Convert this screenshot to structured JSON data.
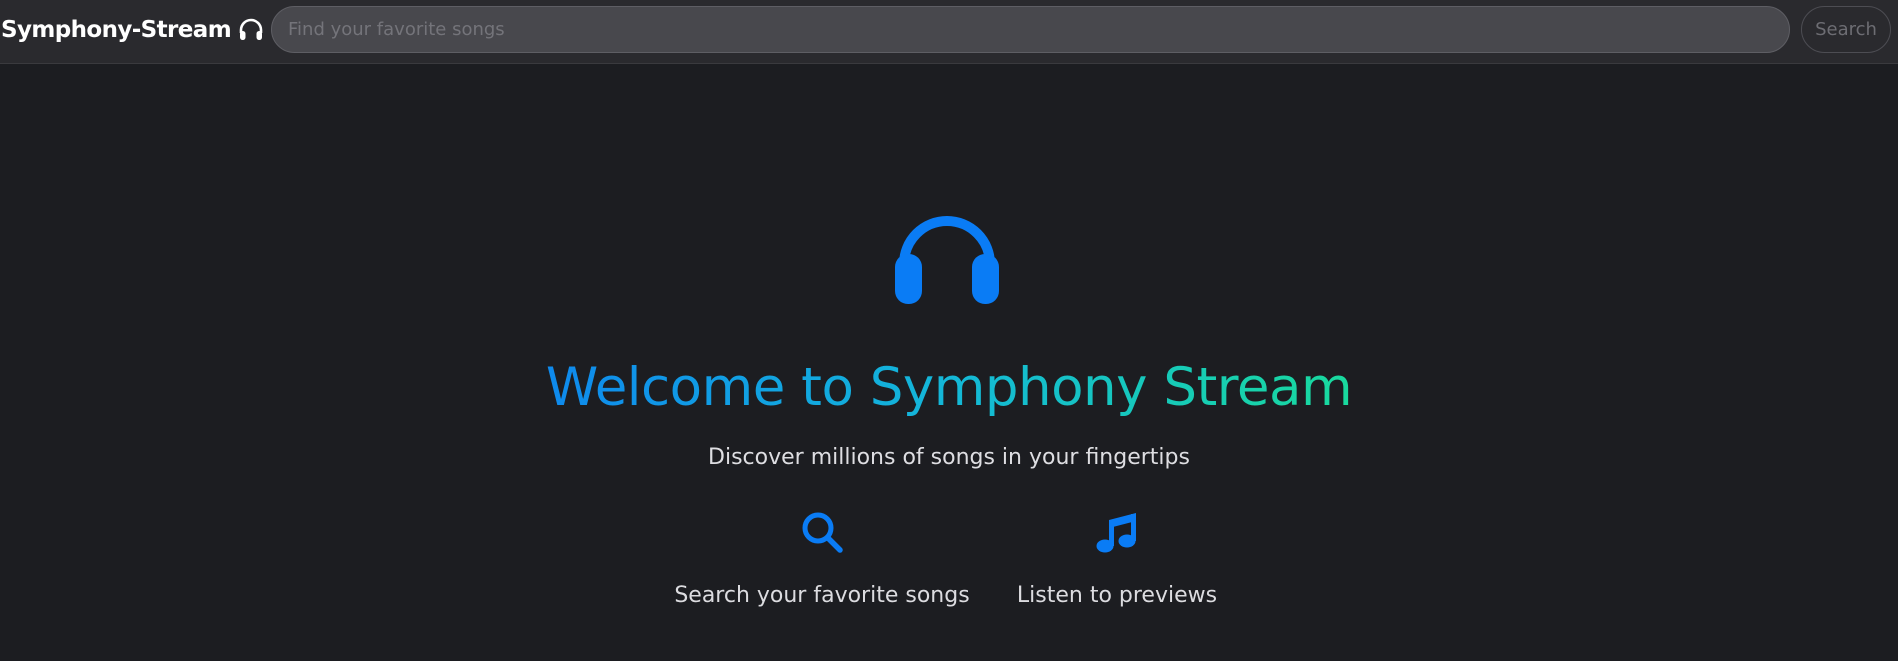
{
  "navbar": {
    "brand": "Symphony-Stream",
    "brand_icon": "headphones-icon",
    "search": {
      "placeholder": "Find your favorite songs",
      "value": "",
      "button_label": "Search"
    }
  },
  "hero": {
    "icon": "headphones-icon",
    "title": "Welcome to Symphony Stream",
    "subtitle": "Discover millions of songs in your fingertips"
  },
  "features": [
    {
      "icon": "search-icon",
      "label": "Search your favorite songs"
    },
    {
      "icon": "music-note-icon",
      "label": "Listen to previews"
    }
  ],
  "colors": {
    "background": "#1c1d21",
    "navbar": "#2a2a2e",
    "accent": "#0a7cf5",
    "title_gradient_start": "#0d7ef2",
    "title_gradient_end": "#1ae28f"
  }
}
